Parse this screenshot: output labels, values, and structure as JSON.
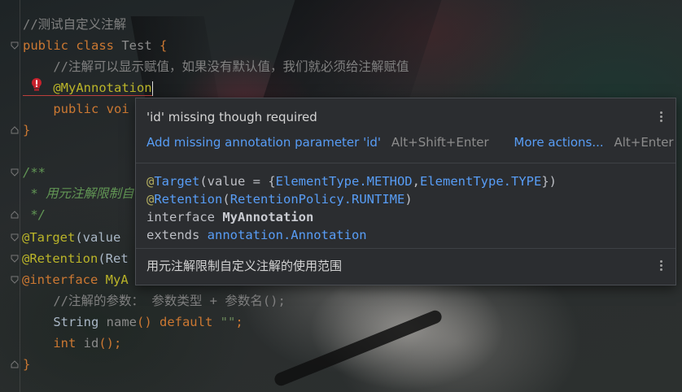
{
  "editor": {
    "lines": [
      {
        "text": "//测试自定义注解"
      },
      {
        "kw": "public class ",
        "name": "Test",
        "rest": " {"
      },
      {
        "text": "    //注解可以显示赋值，如果没有默认值，我们就必须给注解赋值"
      },
      {
        "ann": "    @MyAnnotation"
      },
      {
        "kw": "    public voi"
      },
      {
        "text": "}"
      },
      {
        "text": ""
      },
      {
        "text": "/**"
      },
      {
        "text": " * 用元注解限制自"
      },
      {
        "text": " */"
      },
      {
        "ann": "@Target",
        "rest": "(value"
      },
      {
        "ann": "@Retention",
        "rest": "(Ret"
      },
      {
        "ann": "@interface ",
        "rest": "MyA"
      },
      {
        "text": "    //注解的参数： 参数类型 + 参数名();"
      },
      {
        "type": "    String ",
        "name": "name",
        "paren": "() ",
        "kw": "default ",
        "str": "\"\"",
        "end": ";"
      },
      {
        "type": "    int ",
        "name": "id",
        "paren": "();"
      },
      {
        "text": "}"
      }
    ]
  },
  "popup": {
    "error_title": "'id' missing though required",
    "fix_action": "Add missing annotation parameter 'id'",
    "fix_shortcut": "Alt+Shift+Enter",
    "more_actions": "More actions...",
    "more_shortcut": "Alt+Enter",
    "decl": {
      "line1_at": "@",
      "line1_target": "Target",
      "line1_mid": "(value = {",
      "line1_et1": "ElementType.METHOD",
      "line1_comma": ",",
      "line1_et2": "ElementType.TYPE",
      "line1_end": "})",
      "line2_at": "@",
      "line2_retention": "Retention",
      "line2_open": "(",
      "line2_policy": "RetentionPolicy.RUNTIME",
      "line2_close": ")",
      "line3_kw": "interface ",
      "line3_name": "MyAnnotation",
      "line4_kw": "extends ",
      "line4_type": "annotation.Annotation"
    },
    "doc": "用元注解限制自定义注解的使用范围"
  },
  "colors": {
    "keyword": "#cc7832",
    "annotation": "#bbb529",
    "comment": "#808080",
    "link": "#589df6",
    "error": "#bc3f3c"
  }
}
